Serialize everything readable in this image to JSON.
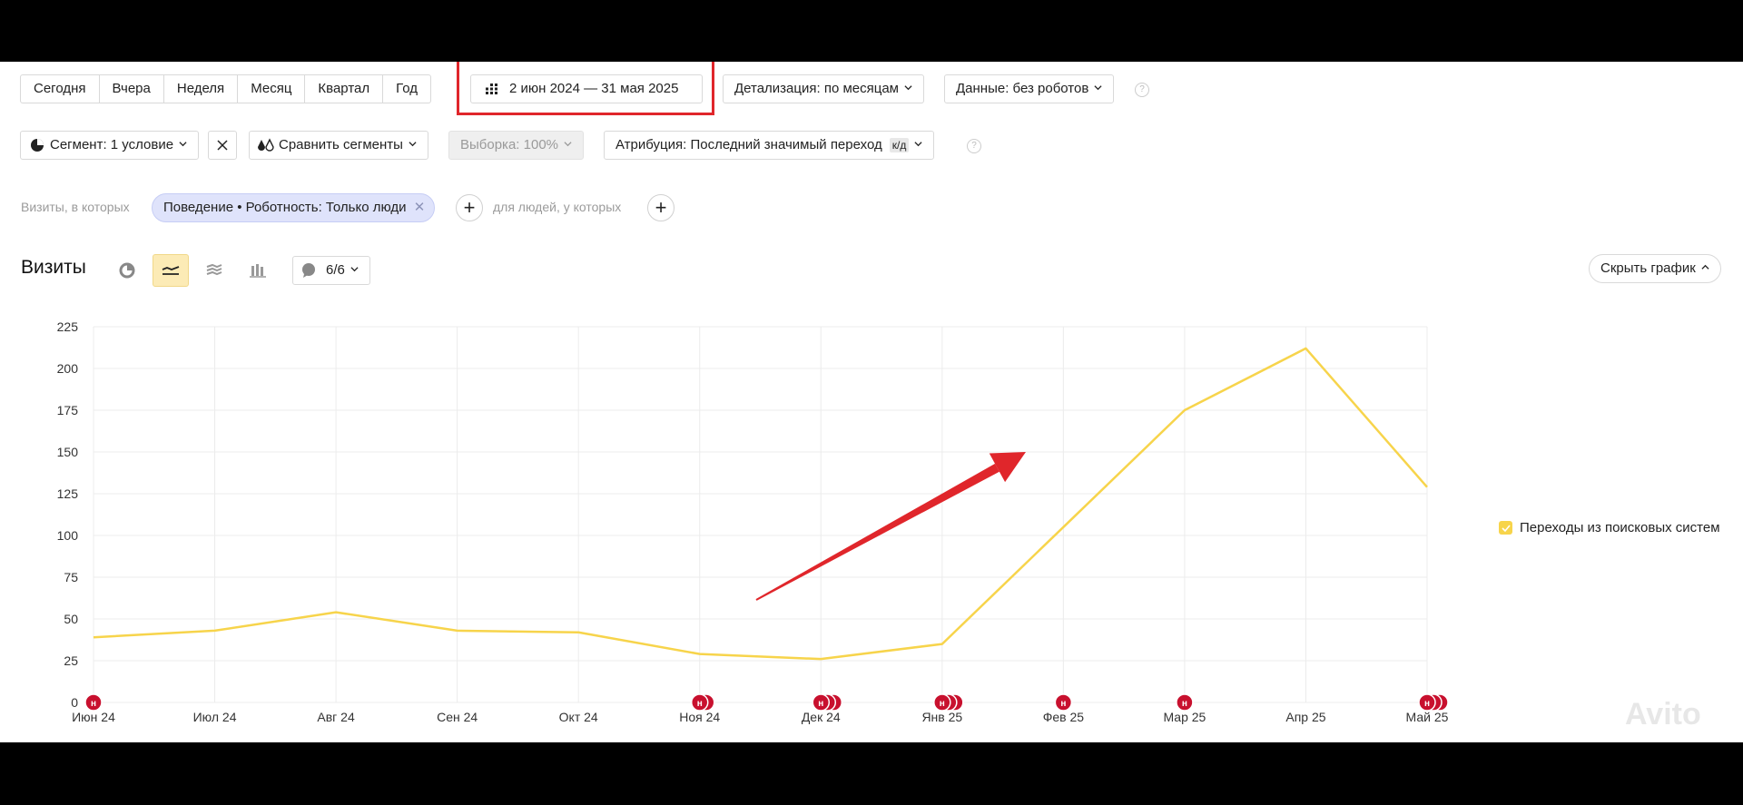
{
  "toolbar": {
    "periods": [
      "Сегодня",
      "Вчера",
      "Неделя",
      "Месяц",
      "Квартал",
      "Год"
    ],
    "date_range": "2 июн 2024 — 31 мая 2025",
    "detail": "Детализация: по месяцам",
    "data": "Данные: без роботов"
  },
  "row2": {
    "segment": "Сегмент: 1 условие",
    "compare": "Сравнить сегменты",
    "sample": "Выборка: 100%",
    "attribution": "Атрибуция: Последний значимый переход",
    "attribution_badge": "к/д"
  },
  "filters": {
    "visits_label": "Визиты, в которых",
    "chip": "Поведение • Роботность: Только люди",
    "people_label": "для людей, у которых"
  },
  "report": {
    "title": "Визиты",
    "series_count": "6/6",
    "hide_chart": "Скрыть график"
  },
  "chart_data": {
    "type": "line",
    "categories": [
      "Июн 24",
      "Июл 24",
      "Авг 24",
      "Сен 24",
      "Окт 24",
      "Ноя 24",
      "Дек 24",
      "Янв 25",
      "Фев 25",
      "Мар 25",
      "Апр 25",
      "Май 25"
    ],
    "series": [
      {
        "name": "Переходы из поисковых систем",
        "values": [
          39,
          43,
          54,
          43,
          42,
          29,
          26,
          35,
          105,
          175,
          212,
          129
        ],
        "color": "#f7d44b"
      }
    ],
    "yticks": [
      0,
      25,
      50,
      75,
      100,
      125,
      150,
      175,
      200,
      225
    ],
    "ylim": [
      0,
      225
    ],
    "grid": true,
    "legend": "right",
    "annotation_marker_counts": [
      1,
      0,
      0,
      0,
      0,
      2,
      3,
      3,
      1,
      1,
      0,
      3
    ],
    "annotation_marker_letter": "н",
    "arrow_color": "#e0262b"
  },
  "colors": {
    "accent_line": "#f7d44b",
    "highlight_red": "#e0262b",
    "marker_red": "#c8102e"
  },
  "watermark": "Avito"
}
